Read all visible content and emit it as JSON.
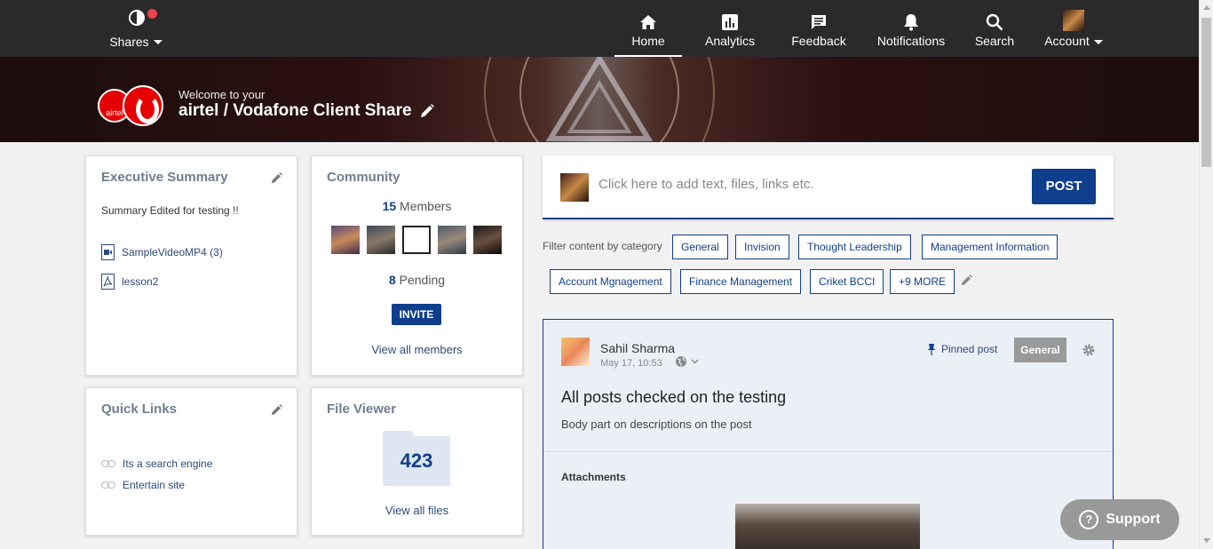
{
  "nav": {
    "shares_label": "Shares",
    "items": [
      {
        "label": "Home",
        "icon": "home-icon"
      },
      {
        "label": "Analytics",
        "icon": "analytics-icon"
      },
      {
        "label": "Feedback",
        "icon": "feedback-icon"
      },
      {
        "label": "Notifications",
        "icon": "bell-icon"
      },
      {
        "label": "Search",
        "icon": "search-icon"
      },
      {
        "label": "Account",
        "icon": "avatar"
      }
    ]
  },
  "banner": {
    "welcome": "Welcome to your",
    "title": "airtel / Vodafone Client Share",
    "airtel_logo_text": "airtel"
  },
  "executive_summary": {
    "title": "Executive Summary",
    "text": "Summary Edited for testing !!",
    "files": [
      "SampleVideoMP4 (3)",
      "lesson2"
    ]
  },
  "community": {
    "title": "Community",
    "members_count": "15",
    "members_label": "Members",
    "pending_count": "8",
    "pending_label": "Pending",
    "invite_label": "INVITE",
    "view_all": "View all members"
  },
  "quick_links": {
    "title": "Quick Links",
    "links": [
      "Its a search engine",
      "Entertain site"
    ]
  },
  "file_viewer": {
    "title": "File Viewer",
    "count": "423",
    "view_all": "View all files"
  },
  "composer": {
    "placeholder": "Click here to add text, files, links etc.",
    "post_label": "POST"
  },
  "filter": {
    "label": "Filter content by category",
    "categories": [
      "General",
      "Invision",
      "Thought Leadership",
      "Management Information",
      "Account Mgnagement",
      "Finance Management",
      "Criket BCCI",
      "+9 MORE"
    ]
  },
  "post": {
    "author": "Sahil Sharma",
    "date": "May 17, 10:53",
    "pinned": "Pinned post",
    "tag": "General",
    "title": "All posts checked on the testing",
    "body": "Body part on descriptions on the post",
    "attachments_label": "Attachments"
  },
  "support": {
    "label": "Support"
  },
  "colors": {
    "primary": "#0f3f8c",
    "nav_bg": "#2a2a2a",
    "alert_dot": "#e8424a"
  }
}
